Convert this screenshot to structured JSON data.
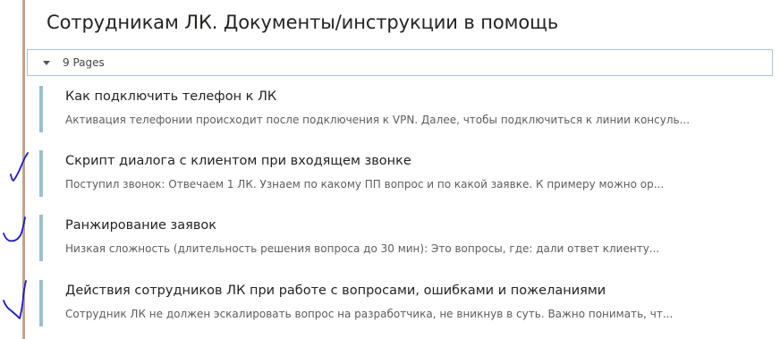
{
  "section": {
    "title": "Сотрудникам ЛК. Документы/инструкции в помощь"
  },
  "pages_toggle": {
    "label": "9 Pages"
  },
  "pages": [
    {
      "title": "Как подключить телефон к ЛК",
      "excerpt": "Активация телефонии происходит после подключения к VPN. Далее, чтобы подключиться к линии консуль..."
    },
    {
      "title": "Скрипт диалога с клиентом при входящем звонке",
      "excerpt": "Поступил звонок: Отвечаем 1 ЛК. Узнаем по какому ПП вопрос и по какой заявке. К примеру можно ор..."
    },
    {
      "title": "Ранжирование заявок",
      "excerpt": "Низкая сложность (длительность решения вопроса до 30 мин): Это вопросы, где: дали ответ клиенту..."
    },
    {
      "title": "Действия сотрудников ЛК при работе с вопросами, ошибками и пожеланиями",
      "excerpt": "Сотрудник ЛК не должен эскалировать вопрос на разработчика, не вникнув в суть. Важно понимать, чт..."
    }
  ],
  "colors": {
    "left_rule": "#c8a08a",
    "item_accent": "#9dbfcf",
    "toggle_border": "#a6c4e6",
    "handwritten_marks": "#1d1ad0"
  }
}
